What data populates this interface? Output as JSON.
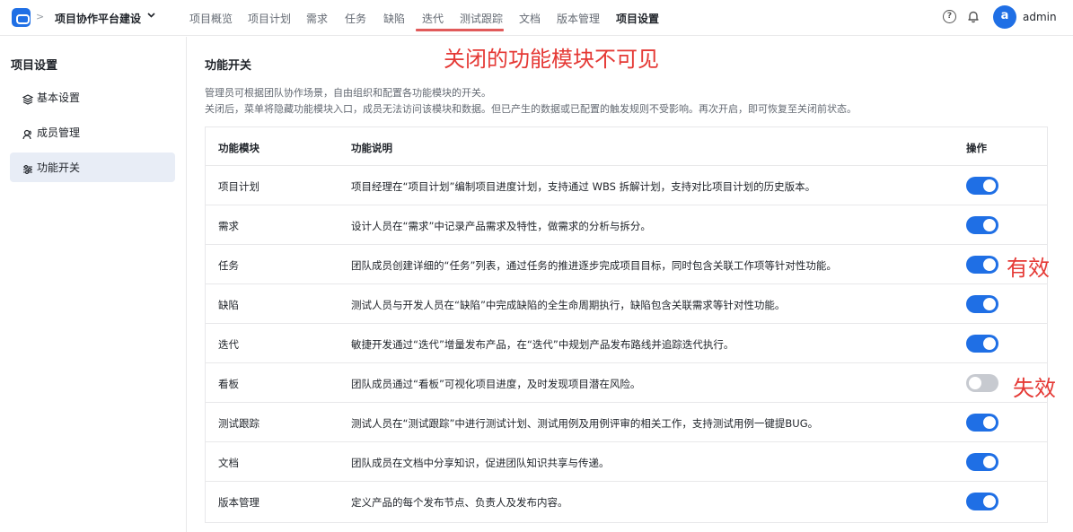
{
  "header": {
    "project_name": "项目协作平台建设",
    "tabs": [
      {
        "label": "项目概览"
      },
      {
        "label": "项目计划"
      },
      {
        "label": "需求"
      },
      {
        "label": "任务"
      },
      {
        "label": "缺陷"
      },
      {
        "label": "迭代"
      },
      {
        "label": "测试跟踪"
      },
      {
        "label": "文档"
      },
      {
        "label": "版本管理"
      },
      {
        "label": "项目设置",
        "active": true
      }
    ],
    "avatar_letter": "a",
    "username": "admin"
  },
  "sidebar": {
    "title": "项目设置",
    "items": [
      {
        "label": "基本设置",
        "icon": "layers-icon"
      },
      {
        "label": "成员管理",
        "icon": "users-icon"
      },
      {
        "label": "功能开关",
        "icon": "sliders-icon",
        "active": true
      }
    ]
  },
  "main": {
    "title": "功能开关",
    "description_lines": [
      "管理员可根据团队协作场景，自由组织和配置各功能模块的开关。",
      "关闭后，菜单将隐藏功能模块入口，成员无法访问该模块和数据。但已产生的数据或已配置的触发规则不受影响。再次开启，即可恢复至关闭前状态。"
    ],
    "table": {
      "columns": [
        "功能模块",
        "功能说明",
        "操作"
      ],
      "rows": [
        {
          "name": "项目计划",
          "desc": "项目经理在“项目计划”编制项目进度计划，支持通过 WBS 拆解计划，支持对比项目计划的历史版本。",
          "enabled": true
        },
        {
          "name": "需求",
          "desc": "设计人员在“需求”中记录产品需求及特性，做需求的分析与拆分。",
          "enabled": true
        },
        {
          "name": "任务",
          "desc": "团队成员创建详细的“任务”列表，通过任务的推进逐步完成项目目标，同时包含关联工作项等针对性功能。",
          "enabled": true
        },
        {
          "name": "缺陷",
          "desc": "测试人员与开发人员在“缺陷”中完成缺陷的全生命周期执行，缺陷包含关联需求等针对性功能。",
          "enabled": true
        },
        {
          "name": "迭代",
          "desc": "敏捷开发通过“迭代”增量发布产品，在“迭代”中规划产品发布路线并追踪迭代执行。",
          "enabled": true
        },
        {
          "name": "看板",
          "desc": "团队成员通过“看板”可视化项目进度，及时发现项目潜在风险。",
          "enabled": false
        },
        {
          "name": "测试跟踪",
          "desc": "测试人员在“测试跟踪”中进行测试计划、测试用例及用例评审的相关工作，支持测试用例一键提BUG。",
          "enabled": true
        },
        {
          "name": "文档",
          "desc": "团队成员在文档中分享知识，促进团队知识共享与传递。",
          "enabled": true
        },
        {
          "name": "版本管理",
          "desc": "定义产品的每个发布节点、负责人及发布内容。",
          "enabled": true
        }
      ]
    }
  },
  "annotations": {
    "hidden_modules": "关闭的功能模块不可见",
    "enabled_label": "有效",
    "disabled_label": "失效"
  },
  "colors": {
    "accent": "#1f6fe5",
    "annotation": "#e53935",
    "toggle_off": "#c7cad0"
  }
}
